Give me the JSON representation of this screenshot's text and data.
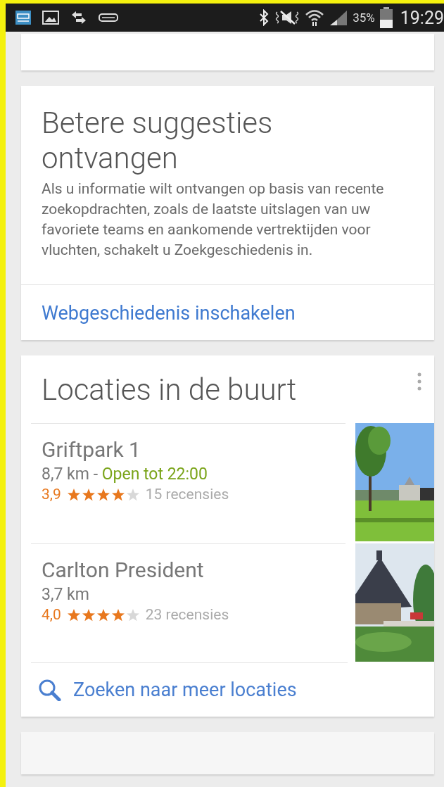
{
  "status_bar": {
    "battery": "35%",
    "time": "19:29"
  },
  "suggestion_card": {
    "title": "Betere suggesties ontvangen",
    "body": "Als u informatie wilt ontvangen op basis van recente zoekopdrachten, zoals de laatste uitslagen van uw favoriete teams en aankomende vertrektijden voor vluchten, schakelt u Zoekgeschiedenis in.",
    "action": "Webgeschiedenis inschakelen"
  },
  "nearby_card": {
    "title": "Locaties in de buurt",
    "places": [
      {
        "name": "Griftpark 1",
        "distance": "8,7 km",
        "separator": " - ",
        "hours": "Open tot 22:00",
        "rating": "3,9",
        "stars": 4,
        "reviews": "15 recensies"
      },
      {
        "name": "Carlton President",
        "distance": "3,7 km",
        "rating": "4,0",
        "stars": 4,
        "reviews": "23 recensies"
      }
    ],
    "more": "Zoeken naar meer locaties"
  }
}
